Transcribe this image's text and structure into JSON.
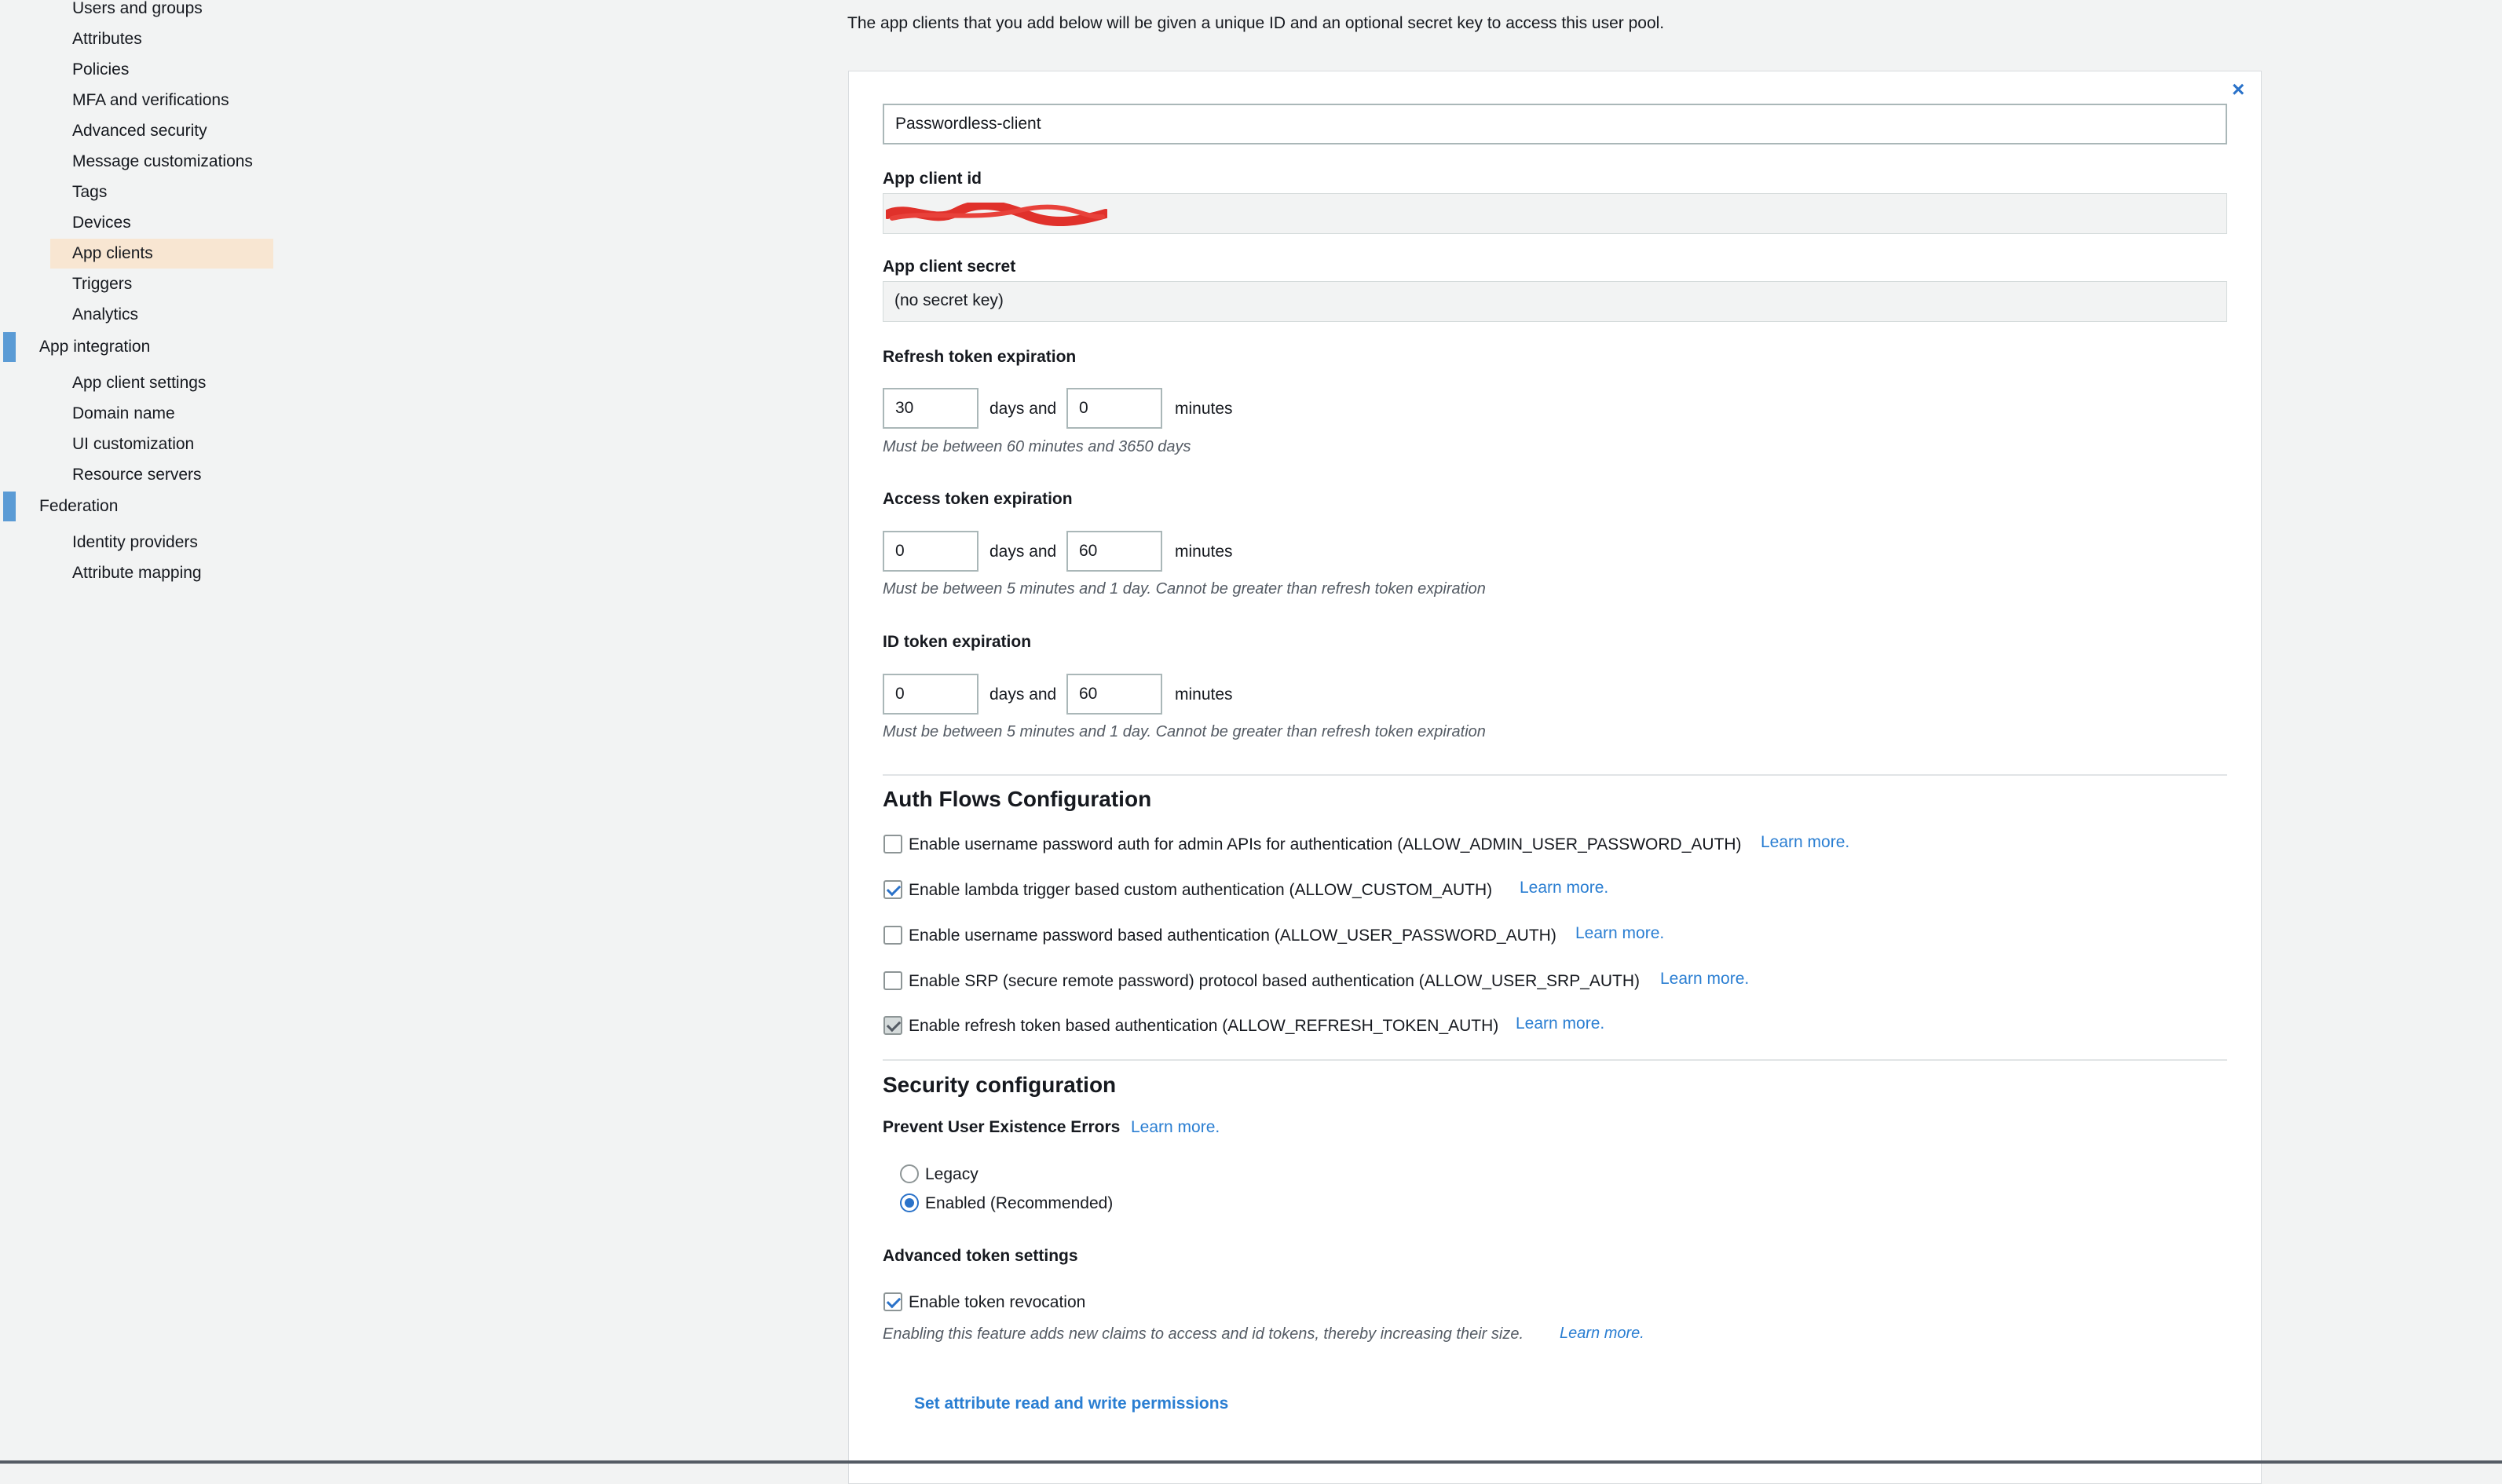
{
  "sidebar": {
    "items": [
      {
        "label": "Users and groups"
      },
      {
        "label": "Attributes"
      },
      {
        "label": "Policies"
      },
      {
        "label": "MFA and verifications"
      },
      {
        "label": "Advanced security"
      },
      {
        "label": "Message customizations"
      },
      {
        "label": "Tags"
      },
      {
        "label": "Devices"
      },
      {
        "label": "App clients",
        "active": true
      },
      {
        "label": "Triggers"
      },
      {
        "label": "Analytics"
      }
    ],
    "app_integration": {
      "label": "App integration",
      "items": [
        {
          "label": "App client settings"
        },
        {
          "label": "Domain name"
        },
        {
          "label": "UI customization"
        },
        {
          "label": "Resource servers"
        }
      ]
    },
    "federation": {
      "label": "Federation",
      "items": [
        {
          "label": "Identity providers"
        },
        {
          "label": "Attribute mapping"
        }
      ]
    }
  },
  "intro": "The app clients that you add below will be given a unique ID and an optional secret key to access this user pool.",
  "client": {
    "name": "Passwordless-client",
    "id_label": "App client id",
    "secret_label": "App client secret",
    "secret_value": "(no secret key)"
  },
  "refresh": {
    "label": "Refresh token expiration",
    "days": "30",
    "minutes": "0",
    "days_text": "days and",
    "minutes_text": "minutes",
    "hint": "Must be between 60 minutes and 3650 days"
  },
  "access": {
    "label": "Access token expiration",
    "days": "0",
    "minutes": "60",
    "days_text": "days and",
    "minutes_text": "minutes",
    "hint": "Must be between 5 minutes and 1 day. Cannot be greater than refresh token expiration"
  },
  "idtoken": {
    "label": "ID token expiration",
    "days": "0",
    "minutes": "60",
    "days_text": "days and",
    "minutes_text": "minutes",
    "hint": "Must be between 5 minutes and 1 day. Cannot be greater than refresh token expiration"
  },
  "auth_flows": {
    "title": "Auth Flows Configuration",
    "learn_more": "Learn more.",
    "items": [
      {
        "label": "Enable username password auth for admin APIs for authentication (ALLOW_ADMIN_USER_PASSWORD_AUTH)",
        "checked": false
      },
      {
        "label": "Enable lambda trigger based custom authentication (ALLOW_CUSTOM_AUTH)",
        "checked": true
      },
      {
        "label": "Enable username password based authentication (ALLOW_USER_PASSWORD_AUTH)",
        "checked": false
      },
      {
        "label": "Enable SRP (secure remote password) protocol based authentication (ALLOW_USER_SRP_AUTH)",
        "checked": false
      },
      {
        "label": "Enable refresh token based authentication (ALLOW_REFRESH_TOKEN_AUTH)",
        "checked": true
      }
    ]
  },
  "security": {
    "title": "Security configuration",
    "prevent_label": "Prevent User Existence Errors",
    "learn_more": "Learn more.",
    "options": [
      {
        "label": "Legacy",
        "selected": false
      },
      {
        "label": "Enabled (Recommended)",
        "selected": true
      }
    ],
    "advanced_label": "Advanced token settings",
    "revocation_label": "Enable token revocation",
    "revocation_checked": true,
    "revocation_hint": "Enabling this feature adds new claims to access and id tokens, thereby increasing their size.",
    "revocation_learn_more": "Learn more."
  },
  "permissions_link": "Set attribute read and write permissions",
  "close_icon": "×",
  "colors": {
    "accent": "#2a72c9",
    "active_nav": "#f8e6d2",
    "section_bar": "#5b9bd5"
  }
}
